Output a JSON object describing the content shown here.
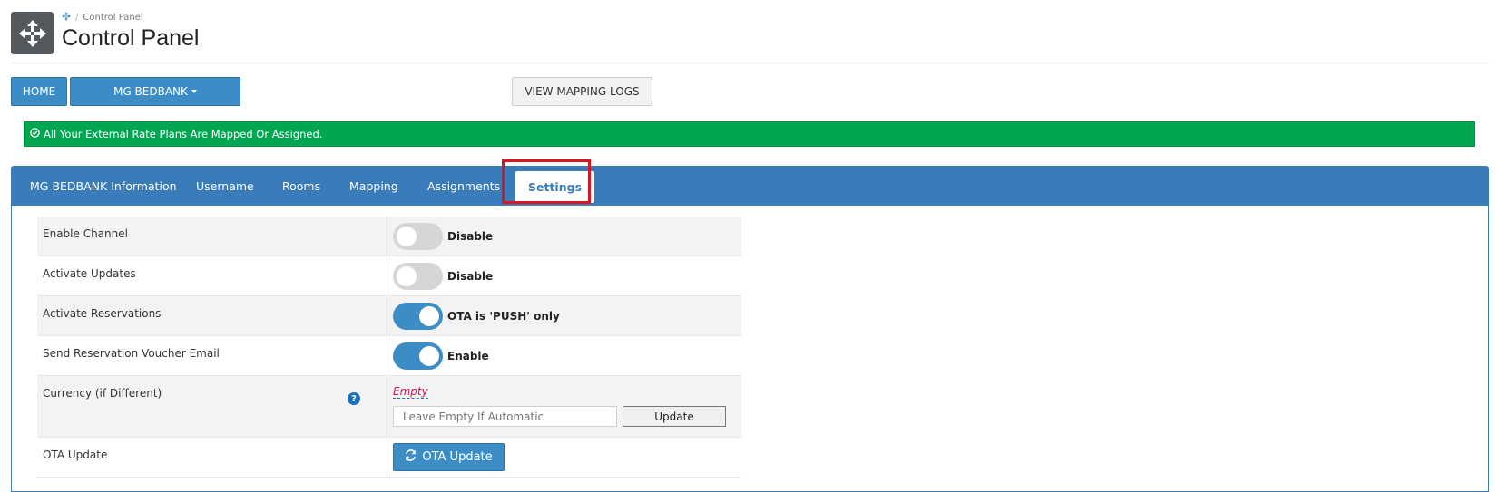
{
  "breadcrumb": {
    "current": "Control Panel"
  },
  "page_title": "Control Panel",
  "toolbar": {
    "home_label": "HOME",
    "channel_label": "MG BEDBANK",
    "logs_label": "VIEW MAPPING LOGS"
  },
  "alert": {
    "message": "All Your External Rate Plans Are Mapped Or Assigned.",
    "color": "#00a651"
  },
  "tabs": [
    {
      "label": "MG BEDBANK Information",
      "active": false
    },
    {
      "label": "Username",
      "active": false
    },
    {
      "label": "Rooms",
      "active": false
    },
    {
      "label": "Mapping",
      "active": false
    },
    {
      "label": "Assignments",
      "active": false
    },
    {
      "label": "Settings",
      "active": true
    }
  ],
  "settings": {
    "enable_channel": {
      "label": "Enable Channel",
      "state": false,
      "status": "Disable"
    },
    "activate_updates": {
      "label": "Activate Updates",
      "state": false,
      "status": "Disable"
    },
    "activate_reservations": {
      "label": "Activate Reservations",
      "state": true,
      "status": "OTA is 'PUSH' only"
    },
    "send_voucher": {
      "label": "Send Reservation Voucher Email",
      "state": true,
      "status": "Enable"
    },
    "currency": {
      "label": "Currency (if Different)",
      "value": "Empty",
      "placeholder": "Leave Empty If Automatic",
      "update_label": "Update"
    },
    "ota_update": {
      "label": "OTA Update",
      "button_label": "OTA Update"
    }
  },
  "colors": {
    "primary": "#3c8dc6",
    "tab_bar": "#3a7bb9",
    "highlight": "#d9151f",
    "empty_text": "#c9194a"
  },
  "icons": {
    "header": "move-arrows-icon",
    "breadcrumb": "move-arrows-icon",
    "alert": "check-circle-icon",
    "help": "question-circle-icon",
    "ota": "refresh-icon"
  }
}
